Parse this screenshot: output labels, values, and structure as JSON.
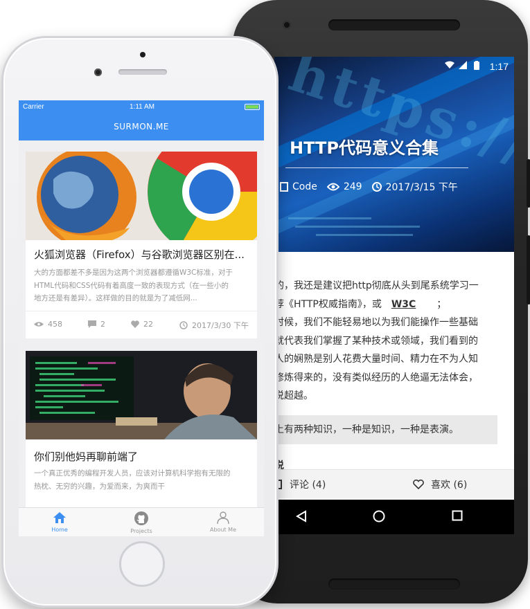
{
  "android": {
    "status_time": "1:17",
    "article": {
      "title": "HTTP代码意义合集",
      "category": "Code",
      "views": "249",
      "date": "2017/3/15 下午",
      "hero_text": "https://www.",
      "body_lines": [
        "的，我还是建议把http彻底从头到尾系统学习一",
        "荐《HTTP权威指南》，或",
        "时候，我们不能轻易地以为我们能操作一些基础",
        "就代表我们掌握了某种技术或领域，我们看到的",
        "人的娴熟是别人花费大量时间、精力在不为人知",
        "修炼得来的，没有类似经历的人绝逼无法体会，",
        "说超越。"
      ],
      "w3c_link": "W3C",
      "w3c_suffix": "；",
      "quote": "上有两种知识，一种是知识，一种是表演。",
      "cutoff_heading": "说"
    },
    "actions": {
      "comments": "评论 (4)",
      "likes": "喜欢 (6)"
    }
  },
  "iphone": {
    "status": {
      "carrier": "Carrier",
      "time": "1:11 AM"
    },
    "header_title": "SURMON.ME",
    "posts": [
      {
        "title": "火狐浏览器（Firefox）与谷歌浏览器区别在...",
        "desc": [
          "大的方面都差不多是因为这两个浏览器都遵循W3C标准，对于",
          "HTML代码和CSS代码有着高度一致的表现方式（在一些小的",
          "地方还是有差异）。这样做的目的就是为了减低网..."
        ],
        "views": "458",
        "comments": "2",
        "likes": "22",
        "date": "2017/3/30 下午"
      },
      {
        "title": "你们别他妈再聊前端了",
        "desc": [
          "一个真正优秀的编程开发人员，应该对计算机科学抱有无限的",
          "热枕、无穷的兴趣，为爱而来，为爽而干"
        ]
      }
    ],
    "tabs": [
      {
        "label": "Home",
        "icon": "home-icon",
        "active": true
      },
      {
        "label": "Projects",
        "icon": "github-icon",
        "active": false
      },
      {
        "label": "About Me",
        "icon": "user-icon",
        "active": false
      }
    ],
    "colors": {
      "accent": "#3c8ff1"
    }
  }
}
